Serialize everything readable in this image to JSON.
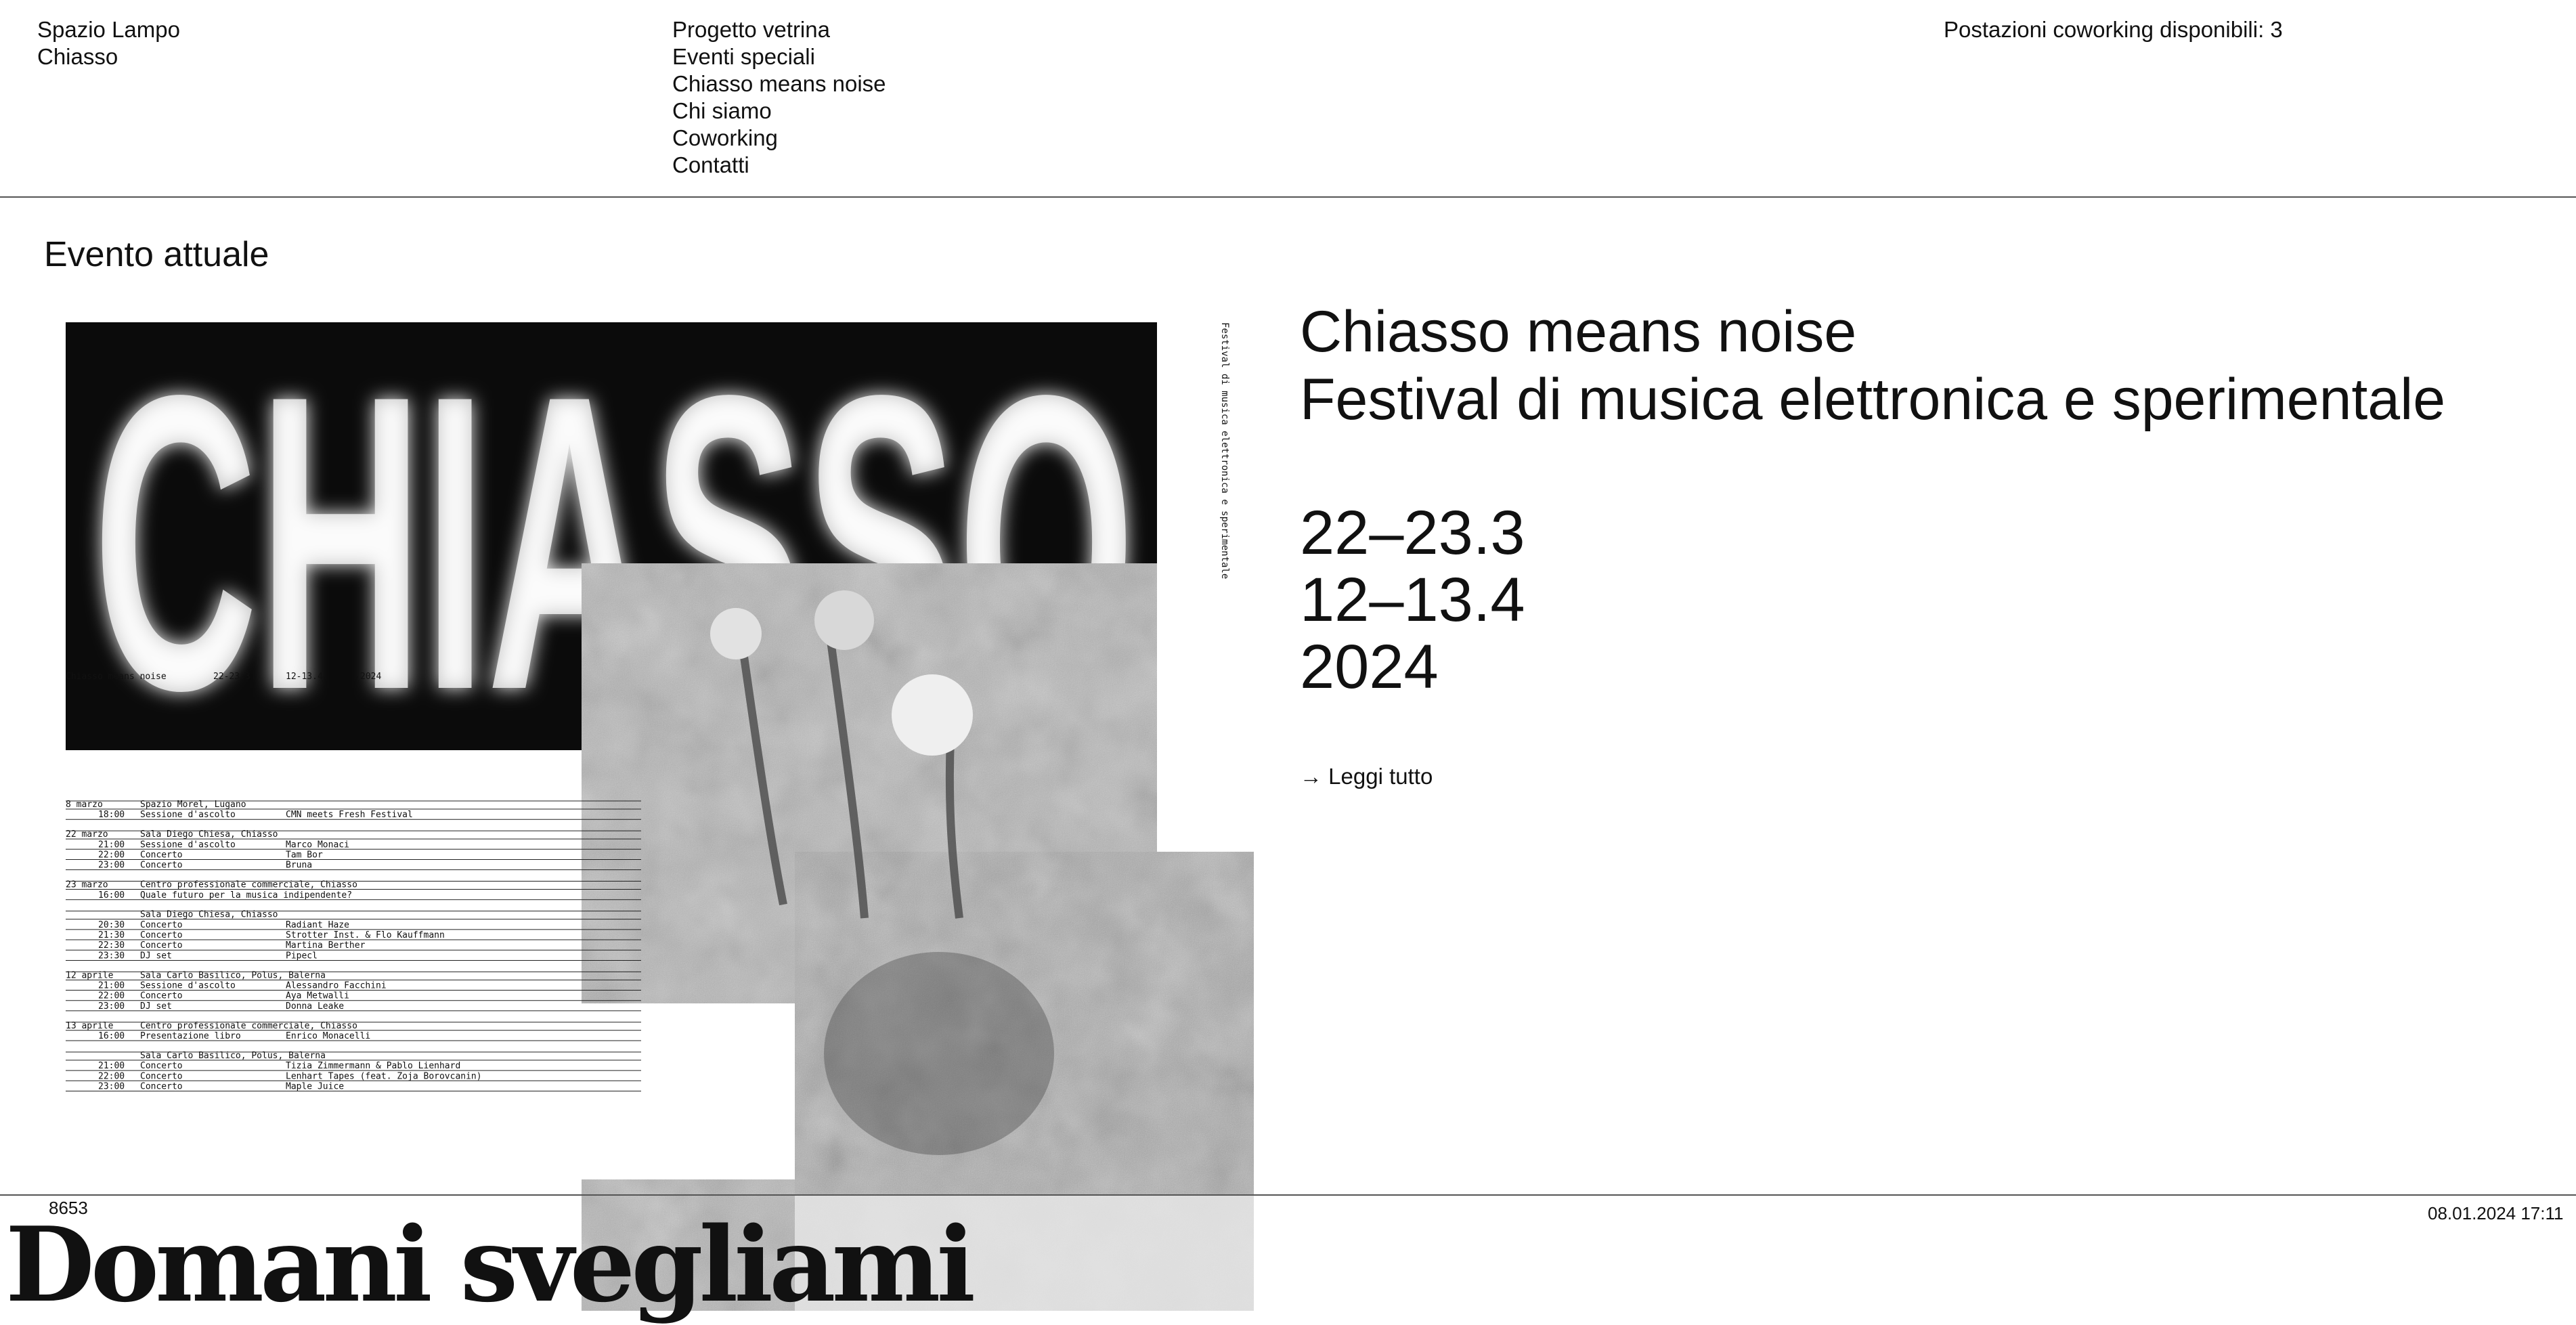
{
  "header": {
    "site_name": "Spazio Lampo",
    "site_location": "Chiasso",
    "nav": [
      {
        "label": "Progetto vetrina"
      },
      {
        "label": "Eventi speciali"
      },
      {
        "label": "Chiasso means noise"
      },
      {
        "label": "Chi siamo"
      },
      {
        "label": "Coworking"
      },
      {
        "label": "Contatti"
      }
    ],
    "coworking_status": "Postazioni coworking disponibili: 3"
  },
  "current_event": {
    "section_title": "Evento attuale",
    "title_line1": "Chiasso means noise",
    "title_line2": "Festival di musica elettronica e sperimentale",
    "dates": [
      "22–23.3",
      "12–13.4",
      "2024"
    ],
    "read_more": "→ Leggi tutto"
  },
  "poster": {
    "headline": "CHIASSO",
    "side_text": "Festival di musica elettronica e sperimentale",
    "strip": [
      "Chiasso means noise",
      "22-23.3",
      "12-13.4",
      "2024"
    ],
    "schedule": [
      {
        "date": "8 marzo",
        "place": "Spazio Morel, Lugano",
        "items": [
          [
            "18:00",
            "Sessione d'ascolto",
            "CMN meets Fresh Festival"
          ]
        ]
      },
      {
        "date": "22 marzo",
        "place": "Sala Diego Chiesa, Chiasso",
        "items": [
          [
            "21:00",
            "Sessione d'ascolto",
            "Marco Monaci"
          ],
          [
            "22:00",
            "Concerto",
            "Tam Bor"
          ],
          [
            "23:00",
            "Concerto",
            "Bruna"
          ]
        ]
      },
      {
        "date": "23 marzo",
        "place": "Centro professionale commerciale, Chiasso",
        "items": [
          [
            "16:00",
            "Quale futuro per la musica indipendente?",
            ""
          ]
        ]
      },
      {
        "date": "",
        "place": "Sala Diego Chiesa, Chiasso",
        "items": [
          [
            "20:30",
            "Concerto",
            "Radiant Haze"
          ],
          [
            "21:30",
            "Concerto",
            "Strotter Inst. & Flo Kauffmann"
          ],
          [
            "22:30",
            "Concerto",
            "Martina Berther"
          ],
          [
            "23:30",
            "DJ set",
            "Pipecl"
          ]
        ]
      },
      {
        "date": "12 aprile",
        "place": "Sala Carlo Basilico, Polus, Balerna",
        "items": [
          [
            "21:00",
            "Sessione d'ascolto",
            "Alessandro Facchini"
          ],
          [
            "22:00",
            "Concerto",
            "Aya Metwalli"
          ],
          [
            "23:00",
            "DJ set",
            "Donna Leake"
          ]
        ]
      },
      {
        "date": "13 aprile",
        "place": "Centro professionale commerciale, Chiasso",
        "items": [
          [
            "16:00",
            "Presentazione libro",
            "Enrico Monacelli"
          ]
        ]
      },
      {
        "date": "",
        "place": "Sala Carlo Basilico, Polus, Balerna",
        "items": [
          [
            "21:00",
            "Concerto",
            "Tizia Zimmermann & Pablo Lienhard"
          ],
          [
            "22:00",
            "Concerto",
            "Lenhart Tapes (feat. Zoja Borovcanin)"
          ],
          [
            "23:00",
            "Concerto",
            "Maple Juice"
          ]
        ]
      }
    ]
  },
  "footer": {
    "zip": "8653",
    "brand": "Domani svegliami",
    "timestamp": "08.01.2024 17:11"
  }
}
